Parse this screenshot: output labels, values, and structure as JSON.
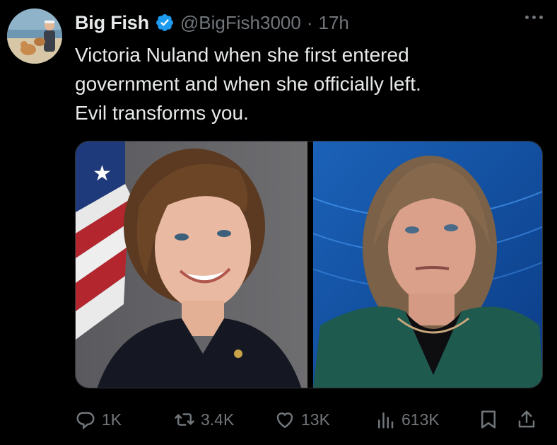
{
  "tweet": {
    "author_name": "Big Fish",
    "handle": "@BigFish3000",
    "separator": "·",
    "time": "17h",
    "text": "Victoria Nuland when she first entered\ngovernment and when she officially left.\nEvil transforms you."
  },
  "metrics": {
    "replies": "1K",
    "retweets": "3.4K",
    "likes": "13K",
    "views": "613K"
  },
  "colors": {
    "background": "#000000",
    "text": "#e7e9ea",
    "muted": "#71767b",
    "verified": "#1d9bf0"
  },
  "icons": {
    "verified": "verified-badge-icon",
    "more": "more-icon",
    "reply": "reply-icon",
    "retweet": "retweet-icon",
    "like": "heart-icon",
    "views": "analytics-icon",
    "bookmark": "bookmark-icon",
    "share": "share-icon"
  }
}
